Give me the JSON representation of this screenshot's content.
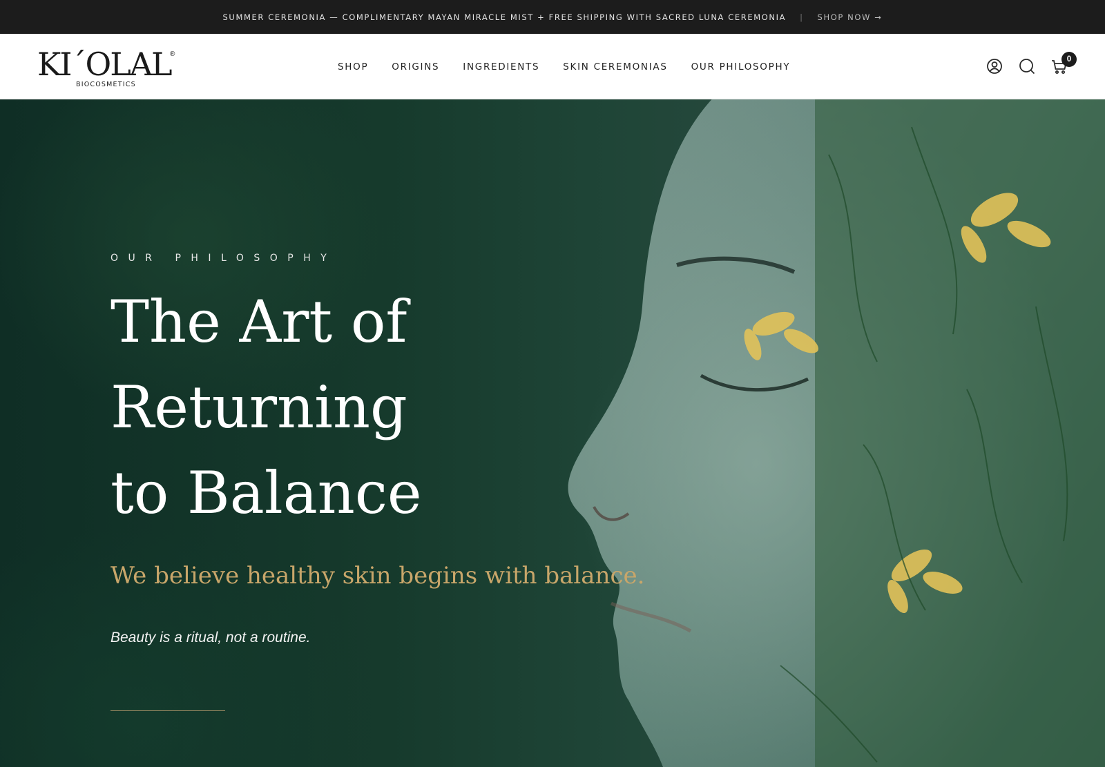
{
  "announcement": {
    "text": "SUMMER CEREMONIA — COMPLIMENTARY MAYAN MIRACLE MIST + FREE SHIPPING WITH SACRED LUNA CEREMONIA",
    "separator": "|",
    "cta": "SHOP NOW →"
  },
  "header": {
    "logo": {
      "name": "KI´OLAL",
      "registered": "®",
      "sub": "BIOCOSMETICS"
    },
    "nav": [
      "SHOP",
      "ORIGINS",
      "INGREDIENTS",
      "SKIN CEREMONIAS",
      "OUR PHILOSOPHY"
    ],
    "icons": {
      "account": "account-icon",
      "search": "search-icon",
      "cart": "cart-icon"
    },
    "cart_count": "0"
  },
  "hero": {
    "eyebrow": "OUR PHILOSOPHY",
    "headline_lines": [
      "The Art of",
      "Returning",
      "to Balance"
    ],
    "tagline": "We believe healthy skin begins with balance.",
    "subline": "Beauty is a ritual, not a routine."
  },
  "colors": {
    "announce_bg": "#1c1c1c",
    "header_bg": "#ffffff",
    "hero_text": "#ffffff",
    "accent_gold": "#c8a66a",
    "hero_green": "#163a2c"
  }
}
